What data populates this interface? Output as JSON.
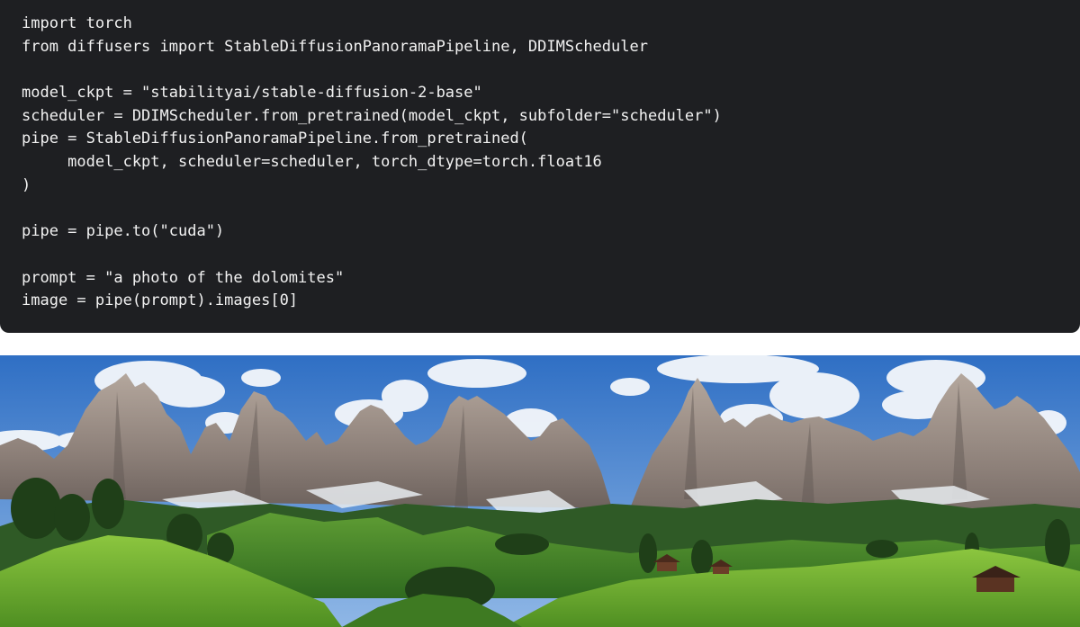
{
  "code_block": {
    "lines": [
      "import torch",
      "from diffusers import StableDiffusionPanoramaPipeline, DDIMScheduler",
      "",
      "model_ckpt = \"stabilityai/stable-diffusion-2-base\"",
      "scheduler = DDIMScheduler.from_pretrained(model_ckpt, subfolder=\"scheduler\")",
      "pipe = StableDiffusionPanoramaPipeline.from_pretrained(",
      "     model_ckpt, scheduler=scheduler, torch_dtype=torch.float16",
      ")",
      "",
      "pipe = pipe.to(\"cuda\")",
      "",
      "prompt = \"a photo of the dolomites\"",
      "image = pipe(prompt).images[0]"
    ],
    "background": "#1e1f22",
    "text_color": "#f2f2f2"
  },
  "panorama": {
    "sky_color": "#3f7fd0",
    "rock_color": "#a69a92",
    "meadow_color": "#7fb83a",
    "forest_color": "#1f4a1e"
  }
}
